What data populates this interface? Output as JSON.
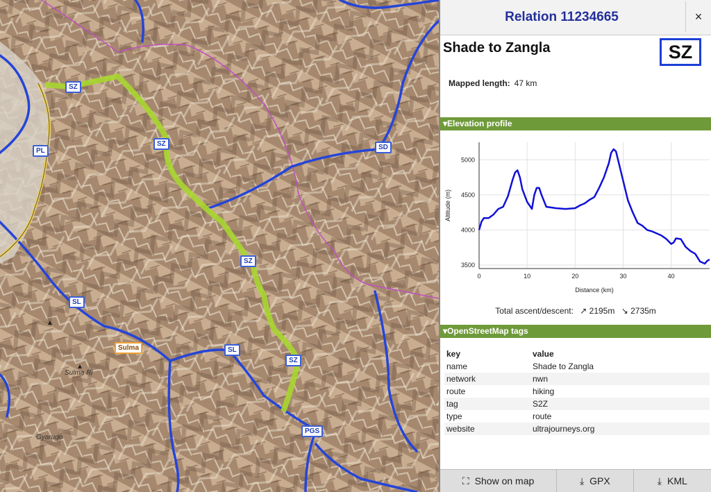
{
  "panel": {
    "title": "Relation 11234665",
    "close_label": "×",
    "route_name": "Shade to Zangla",
    "badge": "SZ",
    "mapped_length_label": "Mapped length:",
    "mapped_length_value": "47 km"
  },
  "elevation": {
    "section_title": "Elevation profile",
    "ascent_label": "Total ascent/descent:",
    "ascent_value": "↗ 2195m",
    "descent_value": "↘ 2735m"
  },
  "chart_data": {
    "type": "line",
    "title": "",
    "xlabel": "Distance (km)",
    "ylabel": "Altitude (m)",
    "xlim": [
      0,
      48
    ],
    "ylim": [
      3450,
      5250
    ],
    "xticks": [
      0,
      10,
      20,
      30,
      40
    ],
    "yticks": [
      3500,
      4000,
      4500,
      5000
    ],
    "grid": true,
    "color": "#1010d8",
    "series": [
      {
        "x": [
          0,
          0.5,
          1,
          2,
          3,
          4,
          5,
          6,
          7,
          7.5,
          8,
          8.5,
          9,
          10,
          11,
          11.5,
          12,
          12.5,
          13,
          14,
          16,
          18,
          20,
          21,
          22,
          23,
          24,
          25,
          26,
          27,
          27.5,
          28,
          28.5,
          29,
          30,
          31,
          32,
          33,
          34,
          35,
          36,
          37,
          38,
          39,
          40,
          40.5,
          41,
          42,
          43,
          44,
          45,
          46,
          47,
          47.5,
          48
        ],
        "y": [
          4000,
          4120,
          4170,
          4170,
          4220,
          4300,
          4330,
          4480,
          4720,
          4820,
          4850,
          4750,
          4580,
          4400,
          4300,
          4500,
          4600,
          4600,
          4500,
          4330,
          4310,
          4300,
          4310,
          4350,
          4380,
          4430,
          4470,
          4600,
          4750,
          4950,
          5100,
          5150,
          5120,
          4980,
          4700,
          4420,
          4250,
          4100,
          4060,
          4000,
          3980,
          3950,
          3920,
          3870,
          3800,
          3820,
          3880,
          3870,
          3760,
          3700,
          3660,
          3550,
          3520,
          3560,
          3580
        ]
      }
    ]
  },
  "tags": {
    "section_title": "OpenStreetMap tags",
    "header_key": "key",
    "header_value": "value",
    "rows": [
      {
        "key": "name",
        "value": "Shade to Zangla"
      },
      {
        "key": "network",
        "value": "nwn"
      },
      {
        "key": "route",
        "value": "hiking"
      },
      {
        "key": "tag",
        "value": "S2Z"
      },
      {
        "key": "type",
        "value": "route"
      },
      {
        "key": "website",
        "value": "ultrajourneys.org"
      }
    ]
  },
  "footer": {
    "show_on_map": "Show on map",
    "gpx": "GPX",
    "kml": "KML",
    "show_icon": "⛶",
    "download_icon": "⤓"
  },
  "map": {
    "shields": [
      "SZ",
      "SZ",
      "SZ",
      "SZ",
      "PL",
      "SD",
      "SL",
      "SL",
      "PGS",
      "Sulma"
    ],
    "labels": [
      "Sulma Ri",
      "Gyarugo"
    ],
    "route_color": "#a8d630",
    "trail_color": "#2545d8",
    "boundary_color": "#c050c0"
  }
}
